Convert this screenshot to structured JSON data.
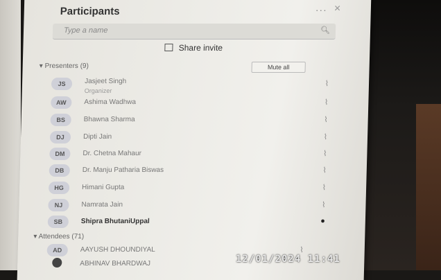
{
  "panel": {
    "title": "Participants",
    "more": "···",
    "close": "×",
    "search_placeholder": "Type a name",
    "share_invite": "Share invite"
  },
  "presenters": {
    "label": "Presenters (9)",
    "mute_all": "Mute all",
    "people": [
      {
        "initials": "JS",
        "name": "Jasjeet Singh",
        "role": "Organizer"
      },
      {
        "initials": "AW",
        "name": "Ashima Wadhwa",
        "role": ""
      },
      {
        "initials": "BS",
        "name": "Bhawna Sharma",
        "role": ""
      },
      {
        "initials": "DJ",
        "name": "Dipti Jain",
        "role": ""
      },
      {
        "initials": "DM",
        "name": "Dr. Chetna Mahaur",
        "role": ""
      },
      {
        "initials": "DB",
        "name": "Dr. Manju Patharia Biswas",
        "role": ""
      },
      {
        "initials": "HG",
        "name": "Himani Gupta",
        "role": ""
      },
      {
        "initials": "NJ",
        "name": "Namrata Jain",
        "role": ""
      },
      {
        "initials": "SB",
        "name": "Shipra BhutaniUppal",
        "role": ""
      }
    ]
  },
  "attendees": {
    "label": "Attendees (71)",
    "people": [
      {
        "initials": "AD",
        "name": "AAYUSH DHOUNDIYAL"
      },
      {
        "initials": "",
        "name": "ABHINAV BHARDWAJ"
      }
    ]
  },
  "icons": {
    "mic": "mic-off-icon"
  },
  "timestamp": "12/01/2024  11:41"
}
